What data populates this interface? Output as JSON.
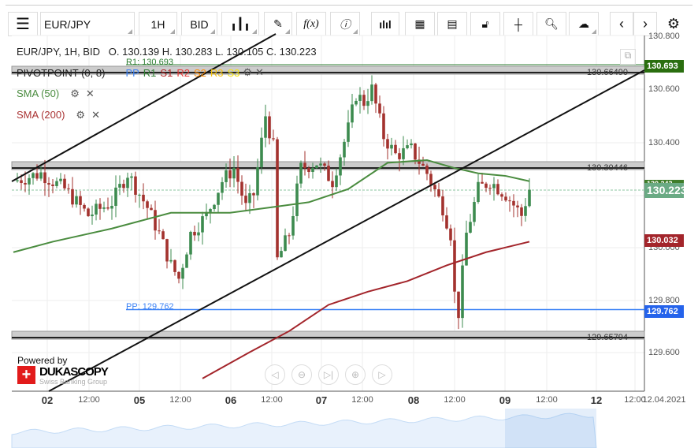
{
  "toolbar": {
    "symbol": "EUR/JPY",
    "timeframe": "1H",
    "side": "BID",
    "fx_label": "f(x)"
  },
  "header": {
    "info": "EUR/JPY, 1H, BID   O. 130.139 H. 130.283 L. 130.105 C. 130.223",
    "r1_label": "R1: 130.693",
    "pivot_label": "PIVOTPOINT (0, 8)",
    "pivot_items": [
      {
        "t": "PP",
        "c": "#3b82f6"
      },
      {
        "t": "R1",
        "c": "#2e7d32"
      },
      {
        "t": "S1",
        "c": "#b22222"
      },
      {
        "t": "R2",
        "c": "#e53935"
      },
      {
        "t": "S2",
        "c": "#ff8c00"
      },
      {
        "t": "R3",
        "c": "#f4c20d"
      },
      {
        "t": "S3",
        "c": "#f4e30d"
      }
    ],
    "sma50": "SMA (50)",
    "sma200": "SMA (200)",
    "pp_label": "PP: 129.762"
  },
  "levels": {
    "top": "130.66490",
    "mid": "130.30446",
    "bottom": "129.65794"
  },
  "price_axis": [
    "130.800",
    "130.600",
    "130.400",
    "130.000",
    "129.800",
    "129.600"
  ],
  "badges": {
    "r1": "130.693",
    "last": "130.223",
    "sma200": "130.032",
    "pp": "129.762",
    "hidden": "130.243"
  },
  "x_axis": [
    {
      "t": "02",
      "d": 1
    },
    {
      "t": "12:00"
    },
    {
      "t": "05",
      "d": 1
    },
    {
      "t": "12:00"
    },
    {
      "t": "06",
      "d": 1
    },
    {
      "t": "12:00"
    },
    {
      "t": "07",
      "d": 1
    },
    {
      "t": "12:00"
    },
    {
      "t": "08",
      "d": 1
    },
    {
      "t": "12:00"
    },
    {
      "t": "09",
      "d": 1
    },
    {
      "t": "12:00"
    },
    {
      "t": "12",
      "d": 1
    },
    {
      "t": "12:00"
    },
    {
      "t": "12.04.2021"
    }
  ],
  "branding": {
    "powered": "Powered by",
    "name": "DUKASCOPY",
    "sub": "Swiss Banking Group"
  },
  "chart_data": {
    "type": "candlestick",
    "symbol": "EUR/JPY",
    "ylim": [
      129.55,
      130.8
    ],
    "path": [
      [
        0,
        130.25
      ],
      [
        7,
        130.28
      ],
      [
        13,
        130.22
      ],
      [
        19,
        130.12
      ],
      [
        25,
        130.17
      ],
      [
        29,
        130.28
      ],
      [
        34,
        130.15
      ],
      [
        37,
        130.05
      ],
      [
        40,
        129.93
      ],
      [
        42,
        129.88
      ],
      [
        45,
        130.05
      ],
      [
        49,
        130.12
      ],
      [
        53,
        130.25
      ],
      [
        56,
        130.3
      ],
      [
        59,
        130.15
      ],
      [
        61,
        130.2
      ],
      [
        64,
        130.5
      ],
      [
        66,
        130.38
      ],
      [
        67,
        129.95
      ],
      [
        70,
        130.05
      ],
      [
        73,
        130.3
      ],
      [
        77,
        130.32
      ],
      [
        81,
        130.25
      ],
      [
        85,
        130.45
      ],
      [
        87,
        130.58
      ],
      [
        89,
        130.55
      ],
      [
        91,
        130.6
      ],
      [
        94,
        130.42
      ],
      [
        97,
        130.35
      ],
      [
        101,
        130.37
      ],
      [
        105,
        130.28
      ],
      [
        109,
        130.15
      ],
      [
        111,
        130.05
      ],
      [
        112,
        129.82
      ],
      [
        113,
        129.75
      ],
      [
        115,
        130.05
      ],
      [
        118,
        130.22
      ],
      [
        121,
        130.25
      ],
      [
        125,
        130.2
      ],
      [
        129,
        130.12
      ],
      [
        131,
        130.22
      ]
    ],
    "sma50": [
      [
        0,
        129.98
      ],
      [
        10,
        130.02
      ],
      [
        25,
        130.07
      ],
      [
        40,
        130.13
      ],
      [
        55,
        130.13
      ],
      [
        65,
        130.15
      ],
      [
        75,
        130.17
      ],
      [
        85,
        130.22
      ],
      [
        95,
        130.32
      ],
      [
        105,
        130.33
      ],
      [
        112,
        130.3
      ],
      [
        118,
        130.28
      ],
      [
        125,
        130.27
      ],
      [
        131,
        130.25
      ]
    ],
    "sma200": [
      [
        48,
        129.5
      ],
      [
        60,
        129.6
      ],
      [
        70,
        129.68
      ],
      [
        80,
        129.78
      ],
      [
        90,
        129.83
      ],
      [
        100,
        129.87
      ],
      [
        110,
        129.93
      ],
      [
        120,
        129.98
      ],
      [
        131,
        130.02
      ]
    ]
  }
}
